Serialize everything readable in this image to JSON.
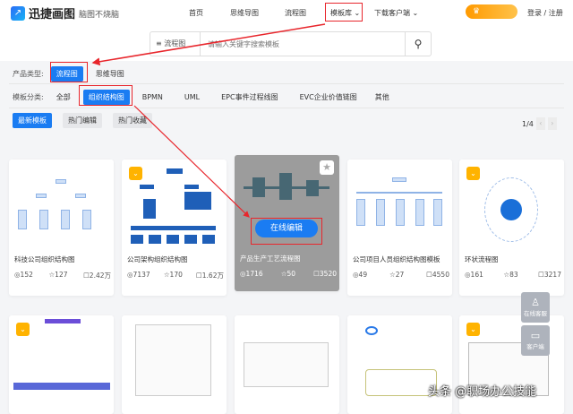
{
  "header": {
    "logo": "迅捷画图",
    "slogan": "脑图不烧脑",
    "nav": [
      "首页",
      "思维导图",
      "流程图",
      "模板库",
      "下载客户端"
    ],
    "vip": "",
    "login": "登录 / 注册"
  },
  "search": {
    "type": "流程图",
    "placeholder": "请输入关键字搜索模板"
  },
  "filters": {
    "product_label": "产品类型:",
    "products": [
      "流程图",
      "思维导图"
    ],
    "category_label": "模板分类:",
    "categories": [
      "全部",
      "组织结构图",
      "BPMN",
      "UML",
      "EPC事件过程线图",
      "EVC企业价值链图",
      "其他"
    ],
    "sorts": [
      "最新模板",
      "热门编辑",
      "热门收藏"
    ],
    "page": "1/4"
  },
  "cards": [
    {
      "title": "科技公司组织结构图",
      "views": "152",
      "stars": "127",
      "edits": "2.42万"
    },
    {
      "title": "公司架构组织结构图",
      "views": "7137",
      "stars": "170",
      "edits": "1.62万"
    },
    {
      "title": "产品生产工艺流程图",
      "views": "1716",
      "stars": "50",
      "edits": "3520",
      "edit_label": "在线编辑"
    },
    {
      "title": "公司项目人员组织结构图模板",
      "views": "49",
      "stars": "27",
      "edits": "4550"
    },
    {
      "title": "环状流程图",
      "views": "161",
      "stars": "83",
      "edits": "3217"
    }
  ],
  "side": {
    "service": "在线客服",
    "client": "客户端"
  },
  "watermark": "头条 @职场办公技能",
  "colors": {
    "accent": "#1a7cf2",
    "annotation": "#e8262c",
    "vip": "#ffa800"
  }
}
